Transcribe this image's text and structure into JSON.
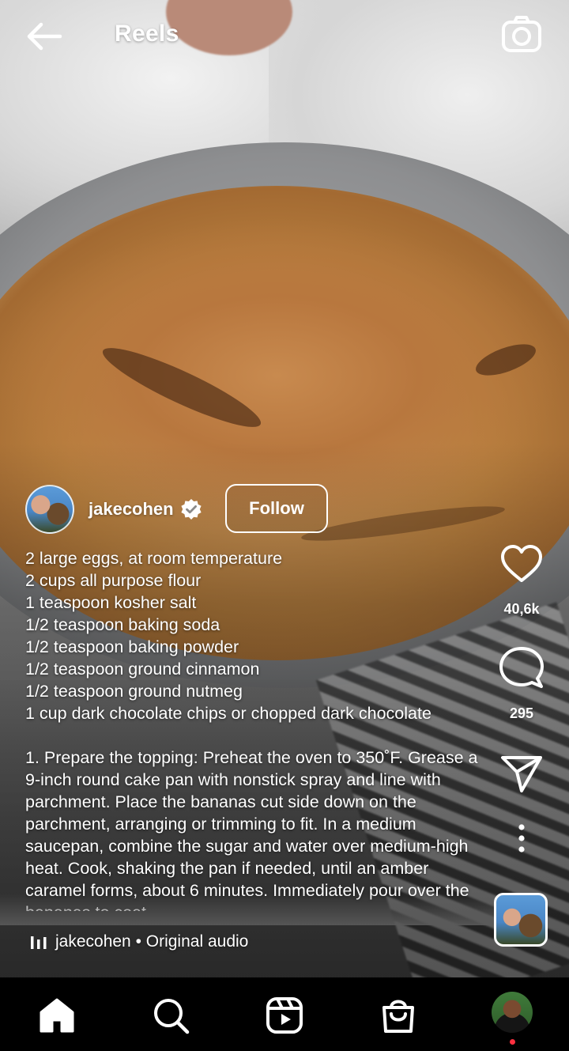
{
  "header": {
    "title": "Reels"
  },
  "post": {
    "username": "jakecohen",
    "follow_label": "Follow",
    "ingredients": [
      "2 large eggs, at room temperature",
      "2 cups all purpose flour",
      "1 teaspoon kosher salt",
      "1/2 teaspoon baking soda",
      "1/2 teaspoon baking powder",
      "1/2 teaspoon ground cinnamon",
      "1/2 teaspoon ground nutmeg",
      "1 cup dark chocolate chips or chopped dark chocolate"
    ],
    "step1": "1. Prepare the topping: Preheat the oven to 350˚F. Grease a 9-inch round cake pan with nonstick spray and line with parchment. Place the bananas cut side down on the parchment, arranging or trimming to fit. In a medium saucepan, combine the sugar and water over medium-high heat. Cook, shaking the pan if needed, until an amber caramel forms, about 6 minutes. Immediately pour over the bananas to coat.",
    "audio": "jakecohen • Original audio"
  },
  "actions": {
    "likes": "40,6k",
    "comments": "295"
  },
  "icons": {
    "back": "arrow-left-icon",
    "camera": "camera-icon",
    "verified": "verified-badge-icon",
    "like": "heart-icon",
    "comment": "comment-icon",
    "share": "send-icon",
    "more": "more-vertical-icon",
    "audio": "audio-bars-icon",
    "home": "home-icon",
    "search": "search-icon",
    "reels": "reels-icon",
    "shop": "shop-icon"
  },
  "colors": {
    "notification_dot": "#ff3040",
    "nav_background": "#000000"
  }
}
